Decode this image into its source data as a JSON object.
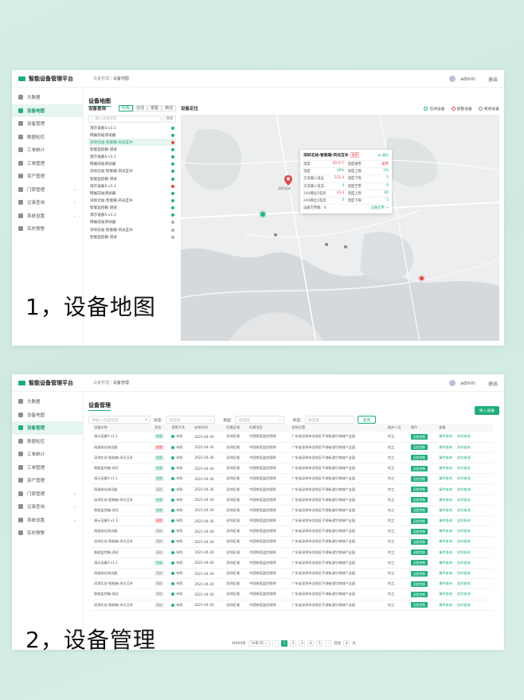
{
  "app": {
    "title": "智能设备管理平台",
    "user": "admin",
    "logout": "退出"
  },
  "sidebar_p1": [
    {
      "label": "大数据",
      "icon": "bigdata-icon"
    },
    {
      "label": "设备地图",
      "icon": "map-icon",
      "active": true
    },
    {
      "label": "设备管理",
      "icon": "device-icon"
    },
    {
      "label": "数据检控",
      "icon": "monitor-icon"
    },
    {
      "label": "工单统计",
      "icon": "chart-icon"
    },
    {
      "label": "工单管理",
      "icon": "ticket-icon"
    },
    {
      "label": "资产管理",
      "icon": "asset-icon"
    },
    {
      "label": "门禁管理",
      "icon": "door-icon",
      "arrow": true
    },
    {
      "label": "记录查询",
      "icon": "record-icon",
      "arrow": true
    },
    {
      "label": "系统设置",
      "icon": "settings-icon",
      "arrow": true
    },
    {
      "label": "实时预警",
      "icon": "alert-icon"
    }
  ],
  "sidebar_p2": [
    {
      "label": "大数据",
      "icon": "bigdata-icon"
    },
    {
      "label": "设备地图",
      "icon": "map-icon"
    },
    {
      "label": "设备管理",
      "icon": "device-icon",
      "active": true
    },
    {
      "label": "数据检控",
      "icon": "monitor-icon"
    },
    {
      "label": "工单统计",
      "icon": "chart-icon"
    },
    {
      "label": "工单管理",
      "icon": "ticket-icon"
    },
    {
      "label": "资产管理",
      "icon": "asset-icon"
    },
    {
      "label": "门禁管理",
      "icon": "door-icon",
      "arrow": true
    },
    {
      "label": "记录查询",
      "icon": "record-icon",
      "arrow": true
    },
    {
      "label": "系统设置",
      "icon": "settings-icon",
      "arrow": true
    },
    {
      "label": "实时预警",
      "icon": "alert-icon"
    }
  ],
  "p1": {
    "breadcrumb_root": "设备管理",
    "breadcrumb_current": "设备地图",
    "page_title": "设备地图",
    "list_title": "设备查询",
    "tabs": [
      "所有",
      "在线",
      "报警",
      "离线"
    ],
    "search_placeholder": "输入设备搜索",
    "search_button": "搜索",
    "devices": [
      {
        "name": "演示设备5-v1.1",
        "status": "g"
      },
      {
        "name": "网展前站测试器",
        "status": "g"
      },
      {
        "name": "深圳北站-智能箱-风光互补",
        "status": "r",
        "selected": true
      },
      {
        "name": "智能监控箱-测试",
        "status": "g"
      },
      {
        "name": "演示设备5-v1.1",
        "status": "g"
      },
      {
        "name": "网展前站测试器",
        "status": "g"
      },
      {
        "name": "深圳北站-智能箱-风光互补",
        "status": "g"
      },
      {
        "name": "智能监控箱-测试",
        "status": "g"
      },
      {
        "name": "演示设备5-v1.1",
        "status": "r"
      },
      {
        "name": "网展前站测试器",
        "status": "g"
      },
      {
        "name": "深圳北站-智能箱-风光互补",
        "status": "g"
      },
      {
        "name": "智能监控箱-测试",
        "status": "g"
      },
      {
        "name": "演示设备5-v1.1",
        "status": "g"
      },
      {
        "name": "网展前站测试器",
        "status": "y"
      },
      {
        "name": "深圳北站-智能箱-风光互补",
        "status": "y"
      },
      {
        "name": "智能监控箱-测试",
        "status": "y"
      }
    ],
    "map_title": "设备定位",
    "legend": {
      "online": "在线设备",
      "alarm": "报警设备",
      "offline": "离线设备"
    },
    "popup": {
      "title": "深圳北站-智能箱-风光互补",
      "tag": "报警",
      "link": "⇄ 通过",
      "rows": [
        [
          "温度",
          "40.0°C",
          "r",
          "湿度报警",
          "报警",
          "r"
        ],
        [
          "湿度",
          "38%",
          "g",
          "湿度上限",
          "3%",
          "g"
        ],
        [
          "交流输入电压",
          "232.4",
          "r",
          "湿度下限",
          "5",
          "g"
        ],
        [
          "交流输入电流",
          "0",
          "g",
          "湿度告警",
          "0",
          "g"
        ],
        [
          "24V输出1电流",
          "24.3",
          "r",
          "湿度上限",
          "60",
          "g"
        ],
        [
          "24V输出1电流",
          "0",
          "g",
          "湿度下限",
          "5",
          "g"
        ]
      ],
      "footer_label": "设备告警数：",
      "footer_value": "0",
      "footer_link": "设备告警 >"
    },
    "map_marker_label": "深圳北站",
    "caption": "1，设备地图"
  },
  "p2": {
    "breadcrumb_root": "设备管理",
    "breadcrumb_current": "设备管理",
    "page_title": "设备管理",
    "search_placeholder": "请输入内容搜索",
    "filter1_label": "状态:",
    "filter1_placeholder": "请选择",
    "filter2_label": "类型:",
    "filter2_placeholder": "请选择",
    "filter3_label": "状态:",
    "filter3_placeholder": "请选择",
    "query_button": "查询",
    "add_button": "导入设备",
    "columns": [
      "设备名称",
      "状态",
      "报警开关",
      "安装时间",
      "所属区域",
      "所属项目",
      "安装位置",
      "维护人员",
      "操作",
      "查看"
    ],
    "rows": [
      [
        "演示设备5-v1.1",
        "在线",
        "on",
        "布防",
        "2021-04-30",
        "深圳区域",
        "中国铁塔监控保障",
        "广东省深圳市龙岗区平湖街道华南城产业园",
        "何工"
      ],
      [
        "网展前站测试器",
        "报警",
        "err",
        "布防",
        "2021-04-30",
        "深圳区域",
        "中国铁塔监控保障",
        "广东省深圳市龙岗区平湖街道华南城产业园",
        "何工"
      ],
      [
        "深圳北站-智能箱-风光互补",
        "在线",
        "on",
        "布防",
        "2021-04-30",
        "深圳区域",
        "中国铁塔监控保障",
        "广东省深圳市龙岗区平湖街道华南城产业园",
        "何工"
      ],
      [
        "智能监控箱-测试",
        "在线",
        "on",
        "布防",
        "2021-04-30",
        "深圳区域",
        "中国铁塔监控保障",
        "广东省深圳市龙岗区平湖街道华南城产业园",
        "何工"
      ],
      [
        "演示设备5-v1.1",
        "在线",
        "on",
        "布防",
        "2021-04-30",
        "深圳区域",
        "中国铁塔监控保障",
        "广东省深圳市龙岗区平湖街道华南城产业园",
        "何工"
      ],
      [
        "网展前站测试器",
        "离线",
        "off",
        "布防",
        "2021-04-30",
        "深圳区域",
        "中国铁塔监控保障",
        "广东省深圳市龙岗区平湖街道华南城产业园",
        "何工"
      ],
      [
        "深圳北站-智能箱-风光互补",
        "在线",
        "on",
        "布防",
        "2021-04-30",
        "深圳区域",
        "中国铁塔监控保障",
        "广东省深圳市龙岗区平湖街道华南城产业园",
        "何工"
      ],
      [
        "智能监控箱-测试",
        "在线",
        "on",
        "布防",
        "2021-04-30",
        "深圳区域",
        "中国铁塔监控保障",
        "广东省深圳市龙岗区平湖街道华南城产业园",
        "何工"
      ],
      [
        "演示设备5-v1.1",
        "报警",
        "err",
        "布防",
        "2021-04-30",
        "深圳区域",
        "中国铁塔监控保障",
        "广东省深圳市龙岗区平湖街道华南城产业园",
        "何工"
      ],
      [
        "网展前站测试器",
        "离线",
        "off",
        "布防",
        "2021-04-30",
        "深圳区域",
        "中国铁塔监控保障",
        "广东省深圳市龙岗区平湖街道华南城产业园",
        "何工"
      ],
      [
        "深圳北站-智能箱-风光互补",
        "离线",
        "off",
        "布防",
        "2021-04-30",
        "深圳区域",
        "中国铁塔监控保障",
        "广东省深圳市龙岗区平湖街道华南城产业园",
        "何工"
      ],
      [
        "智能监控箱-测试",
        "离线",
        "off",
        "布防",
        "2021-04-30",
        "深圳区域",
        "中国铁塔监控保障",
        "广东省深圳市龙岗区平湖街道华南城产业园",
        "何工"
      ],
      [
        "演示设备5-v1.1",
        "在线",
        "on",
        "布防",
        "2021-04-30",
        "深圳区域",
        "中国铁塔监控保障",
        "广东省深圳市龙岗区平湖街道华南城产业园",
        "何工"
      ],
      [
        "网展前站测试器",
        "离线",
        "off",
        "布防",
        "2021-04-30",
        "深圳区域",
        "中国铁塔监控保障",
        "广东省深圳市龙岗区平湖街道华南城产业园",
        "何工"
      ],
      [
        "深圳北站-智能箱-风光互补",
        "离线",
        "off",
        "布防",
        "2021-04-30",
        "深圳区域",
        "中国铁塔监控保障",
        "广东省深圳市龙岗区平湖街道华南城产业园",
        "何工"
      ],
      [
        "智能监控箱-测试",
        "离线",
        "off",
        "布防",
        "2021-04-30",
        "深圳区域",
        "中国铁塔监控保障",
        "广东省深圳市龙岗区平湖街道华南城产业园",
        "何工"
      ],
      [
        "深圳北站-智能箱-风光互补",
        "离线",
        "off",
        "布防",
        "2021-04-30",
        "深圳区域",
        "中国铁塔监控保障",
        "广东省深圳市龙岗区平湖街道华南城产业园",
        "何工"
      ]
    ],
    "op_label": "远程控制",
    "view_links": [
      "事件查询",
      "实时查询"
    ],
    "pager": {
      "total": "共400条",
      "size": "10条/页",
      "pages": [
        "1",
        "2",
        "3",
        "4",
        "5"
      ],
      "goto": "前往",
      "goto_value": "4",
      "suffix": "页"
    },
    "caption": "2，设备管理"
  },
  "colors": {
    "accent": "#1fae7a",
    "alarm": "#e54545",
    "offline": "#aab0b6"
  }
}
